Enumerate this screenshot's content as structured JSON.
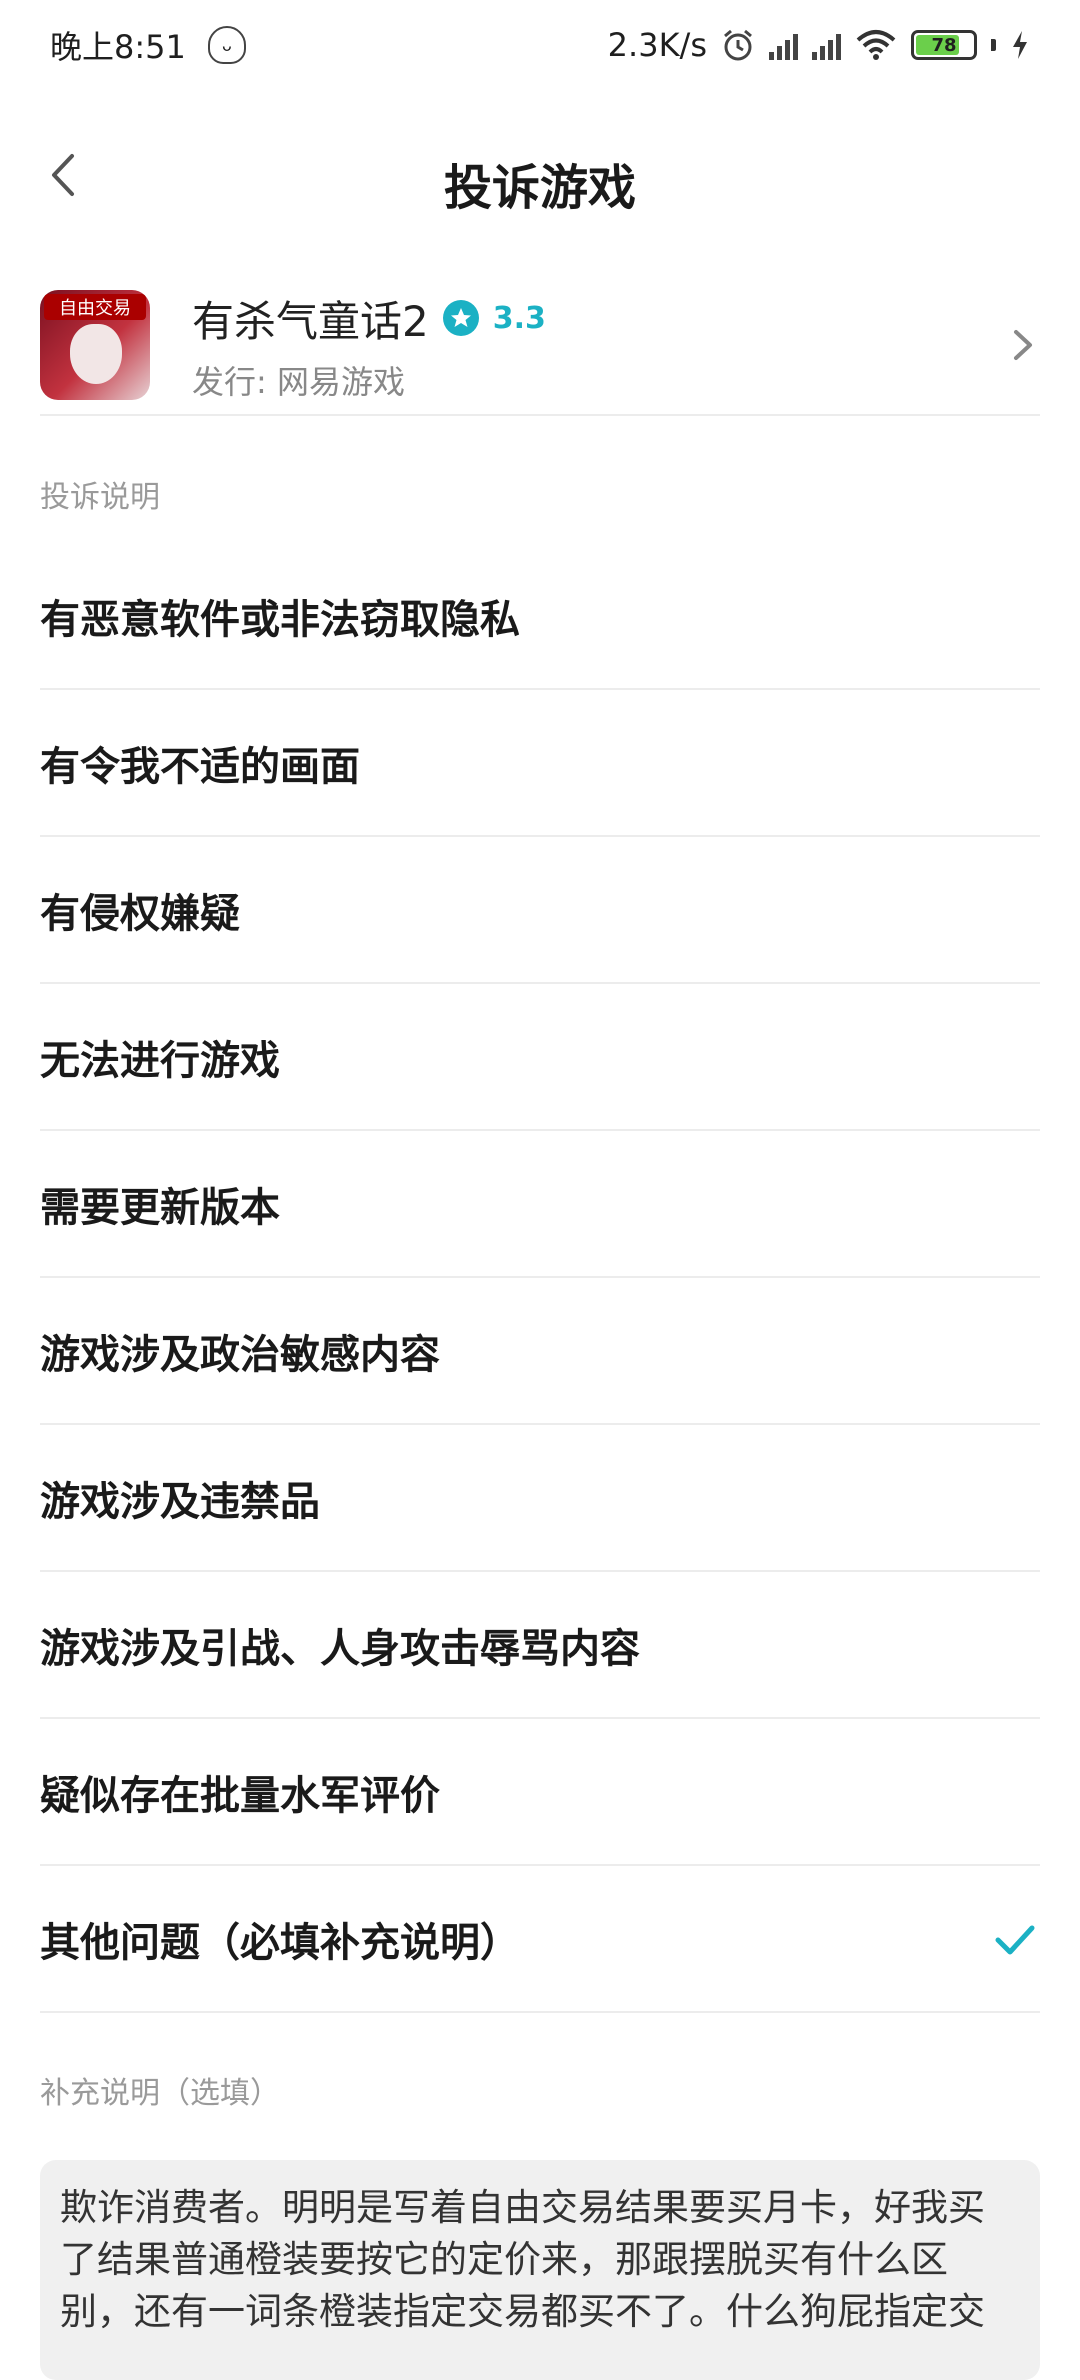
{
  "status_bar": {
    "time": "晚上8:51",
    "speed": "2.3K/s",
    "battery": "78",
    "battery_level": 0.78
  },
  "nav": {
    "title": "投诉游戏"
  },
  "game": {
    "name": "有杀气童话2",
    "rating": "3.3",
    "publisher": "发行: 网易游戏",
    "icon_badge": "自由交易"
  },
  "complaint_section_label": "投诉说明",
  "options": [
    {
      "label": "有恶意软件或非法窃取隐私",
      "selected": false
    },
    {
      "label": "有令我不适的画面",
      "selected": false
    },
    {
      "label": "有侵权嫌疑",
      "selected": false
    },
    {
      "label": "无法进行游戏",
      "selected": false
    },
    {
      "label": "需要更新版本",
      "selected": false
    },
    {
      "label": "游戏涉及政治敏感内容",
      "selected": false
    },
    {
      "label": "游戏涉及违禁品",
      "selected": false
    },
    {
      "label": "游戏涉及引战、人身攻击辱骂内容",
      "selected": false
    },
    {
      "label": "疑似存在批量水军评价",
      "selected": false
    },
    {
      "label": "其他问题（必填补充说明）",
      "selected": true
    }
  ],
  "supplement": {
    "label": "补充说明（选填）",
    "text": "欺诈消费者。明明是写着自由交易结果要买月卡，好我买了结果普通橙装要按它的定价来，那跟摆脱买有什么区别，还有一词条橙装指定交易都买不了。什么狗屁指定交"
  },
  "colors": {
    "accent": "#1bb1c4",
    "divider": "#ececec",
    "textbox_bg": "#f0f0f0"
  }
}
